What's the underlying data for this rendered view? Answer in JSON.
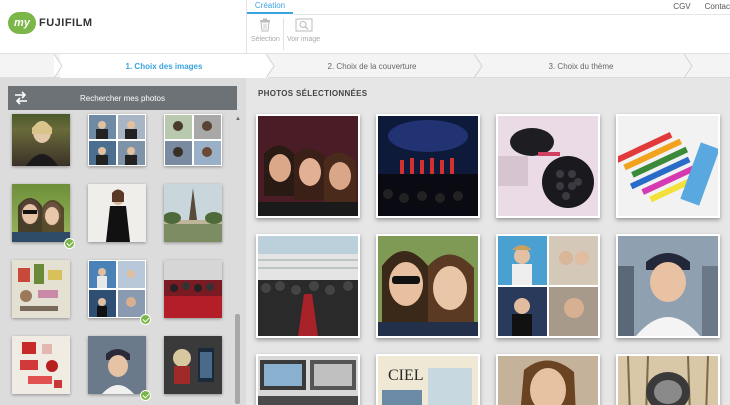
{
  "header": {
    "logo_badge": "my",
    "logo_text": "FUJIFILM",
    "tab_creation": "Création",
    "tools": [
      {
        "label": "Sélection",
        "icon": "trash-icon"
      },
      {
        "label": "Voir image",
        "icon": "image-view-icon"
      }
    ],
    "links": [
      "CGV",
      "Contac"
    ]
  },
  "steps": [
    {
      "label": "1. Choix des images",
      "active": true
    },
    {
      "label": "2. Choix de la couverture",
      "active": false
    },
    {
      "label": "3. Choix du thème",
      "active": false
    }
  ],
  "left_panel": {
    "search_label": "Rechercher mes photos",
    "thumbnails": [
      {
        "subject": "woman-red-carpet",
        "selected": false
      },
      {
        "subject": "collage-men-suits",
        "selected": false
      },
      {
        "subject": "collage-women",
        "selected": false
      },
      {
        "subject": "two-women-selfie",
        "selected": true
      },
      {
        "subject": "woman-black-dress",
        "selected": false
      },
      {
        "subject": "eiffel-tower-park",
        "selected": false
      },
      {
        "subject": "makeup-flatlay",
        "selected": false
      },
      {
        "subject": "collage-people",
        "selected": true
      },
      {
        "subject": "red-carpet-crowd",
        "selected": false
      },
      {
        "subject": "red-objects-flatlay",
        "selected": false
      },
      {
        "subject": "woman-cap-selfie",
        "selected": true
      },
      {
        "subject": "toy-figure",
        "selected": false
      }
    ]
  },
  "right_panel": {
    "title": "PHOTOS SÉLECTIONNÉES",
    "photos": [
      {
        "subject": "three-women-selfie"
      },
      {
        "subject": "stage-dancers"
      },
      {
        "subject": "cake-pop-maker"
      },
      {
        "subject": "colorful-pens"
      },
      {
        "subject": "cannes-red-carpet-crowd"
      },
      {
        "subject": "two-women-selfie"
      },
      {
        "subject": "men-collage"
      },
      {
        "subject": "woman-cap-selfie"
      },
      {
        "subject": "desk-screens"
      },
      {
        "subject": "ciel-magazine"
      },
      {
        "subject": "woman-portrait"
      },
      {
        "subject": "chandelier-shop"
      }
    ],
    "magazine_text": "CIEL"
  },
  "colors": {
    "accent": "#3ba4e0",
    "brand_green": "#7ab648",
    "search_button": "#6c7276",
    "left_bg": "#dcdcdc",
    "right_bg": "#e6e6e6"
  }
}
